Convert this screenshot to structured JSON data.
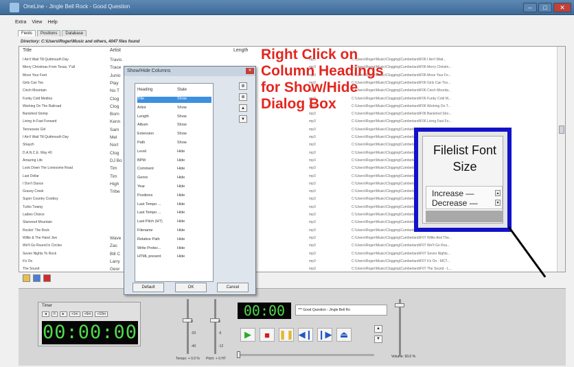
{
  "window": {
    "title": "OneLine - Jingle Bell Rock - Good Question",
    "icons": {
      "minimize": "minimize-icon",
      "maximize": "maximize-icon",
      "close": "close-icon"
    }
  },
  "menu": [
    "Extra",
    "View",
    "Help"
  ],
  "tabs": [
    "Fields",
    "Positions",
    "Database"
  ],
  "directory": "Directory: C:\\Users\\Roger\\Music and others, 4047 files found",
  "columns": {
    "title": "Title",
    "artist": "Artist",
    "length": "Length"
  },
  "files": [
    {
      "title": "I Ain't Wait Till Quittmouth Day",
      "artist": "Travis",
      "ext": "mp3",
      "path": "C:\\Users\\Roger\\Music\\Clogging\\Cumberland\\F06 I Ain't Wait..."
    },
    {
      "title": "Merry Christmas From Texas, Y'all",
      "artist": "Trace",
      "ext": "mp3",
      "path": "C:\\Users\\Roger\\Music\\Clogging\\Cumberland\\F06 Merry Christm..."
    },
    {
      "title": "Move Your Feet",
      "artist": "Junio",
      "ext": "mp3",
      "path": "C:\\Users\\Roger\\Music\\Clogging\\Cumberland\\F06 Move Your Fe..."
    },
    {
      "title": "Girls Can Too",
      "artist": "Play",
      "ext": "mp3",
      "path": "C:\\Users\\Roger\\Music\\Clogging\\Cumberland\\F06 Girls Can Too..."
    },
    {
      "title": "Cinch Mountain",
      "artist": "No T",
      "ext": "mp3",
      "path": "C:\\Users\\Roger\\Music\\Clogging\\Cumberland\\F06 Cinch Mounta..."
    },
    {
      "title": "Funky Cold Medina",
      "artist": "Clog",
      "ext": "mp3",
      "path": "C:\\Users\\Roger\\Music\\Clogging\\Cumberland\\F06 Funky Cold M..."
    },
    {
      "title": "Working On The Railroad",
      "artist": "Clog",
      "ext": "mp3",
      "path": "C:\\Users\\Roger\\Music\\Clogging\\Cumberland\\F06 Working On T..."
    },
    {
      "title": "Banished Stomp",
      "artist": "Born",
      "ext": "mp3",
      "path": "C:\\Users\\Roger\\Music\\Clogging\\Cumberland\\F06 Banished Stro..."
    },
    {
      "title": "Living In Fast Forward",
      "artist": "Kenn",
      "ext": "mp3",
      "path": "C:\\Users\\Roger\\Music\\Clogging\\Cumberland\\F06 Living Fast Fo..."
    },
    {
      "title": "Tennessee Girl",
      "artist": "Sam",
      "ext": "mp3",
      "path": "C:\\Users\\Roger\\Music\\Clogging\\Cumberland\\F06 Tennessee Girl..."
    },
    {
      "title": "I Ain't Wait Till Quittmouth Day",
      "artist": "Mel",
      "ext": "mp3",
      "path": "C:\\Users\\Roger\\Music\\Clogging\\Cumberland\\F06..."
    },
    {
      "title": "Shayzh",
      "artist": "Nort",
      "ext": "mp3",
      "path": "C:\\Users\\Roger\\Music\\Clogging\\Cumberland\\F06..."
    },
    {
      "title": "D.A.N.C.E. Way 40",
      "artist": "Clog",
      "ext": "mp3",
      "path": "C:\\Users\\Roger\\Music\\Clogging\\Cumberland\\F06..."
    },
    {
      "title": "Amazing Life",
      "artist": "DJ Bo",
      "ext": "mp3",
      "path": "C:\\Users\\Roger\\Music\\Clogging\\Cumberland\\F06..."
    },
    {
      "title": "Look Down The Lonesome Road",
      "artist": "Tim",
      "ext": "mp3",
      "path": "C:\\Users\\Roger\\Music\\Clogging\\Cumberland\\F06..."
    },
    {
      "title": "Last Dollar",
      "artist": "Tim",
      "ext": "mp3",
      "path": "C:\\Users\\Roger\\Music\\Clogging\\Cumberland\\F06..."
    },
    {
      "title": "I Don't Dance",
      "artist": "High",
      "ext": "mp3",
      "path": "C:\\Users\\Roger\\Music\\Clogging\\Cumberland\\F06..."
    },
    {
      "title": "Grassy Creek",
      "artist": "Tribe",
      "ext": "mp3",
      "path": "C:\\Users\\Roger\\Music\\Clogging\\Cumberland\\F06..."
    },
    {
      "title": "Super Country Cowboy",
      "artist": "",
      "ext": "mp3",
      "path": "C:\\Users\\Roger\\Music\\Clogging\\Cumberland\\F06..."
    },
    {
      "title": "Turbo Twang",
      "artist": "",
      "ext": "mp3",
      "path": "C:\\Users\\Roger\\Music\\Clogging\\Cumberland\\F06..."
    },
    {
      "title": "Ladies Choice",
      "artist": "",
      "ext": "mp3",
      "path": "C:\\Users\\Roger\\Music\\Clogging\\Cumberland\\F06..."
    },
    {
      "title": "Starwood Mountain",
      "artist": "",
      "ext": "mp3",
      "path": "C:\\Users\\Roger\\Music\\Clogging\\Cumberland\\F06..."
    },
    {
      "title": "Rockin' The Rock",
      "artist": "",
      "ext": "mp3",
      "path": "C:\\Users\\Roger\\Music\\Clogging\\Cumberland\\F06..."
    },
    {
      "title": "Willie & The Hand Jive",
      "artist": "Wave",
      "ext": "mp3",
      "path": "C:\\Users\\Roger\\Music\\Clogging\\Cumberland\\F07 Willie And The..."
    },
    {
      "title": "We'll Go Round In Circles",
      "artist": "Zac",
      "ext": "mp3",
      "path": "C:\\Users\\Roger\\Music\\Clogging\\Cumberland\\F07 We'll Go Rou..."
    },
    {
      "title": "Seven Nights To Rock",
      "artist": "Bill C",
      "ext": "mp3",
      "path": "C:\\Users\\Roger\\Music\\Clogging\\Cumberland\\F07 Seven Nights..."
    },
    {
      "title": "It's On",
      "artist": "Larry",
      "ext": "mp3",
      "path": "C:\\Users\\Roger\\Music\\Clogging\\Cumberland\\F07 It's On - MCT..."
    },
    {
      "title": "The Sound",
      "artist": "Geor",
      "ext": "mp3",
      "path": "C:\\Users\\Roger\\Music\\Clogging\\Cumberland\\F07 The Sound - L..."
    }
  ],
  "list_toolbar_icons": [
    "folder-icon",
    "add-icon",
    "remove-icon"
  ],
  "dialog": {
    "title": "Show/Hide Columns",
    "headers": {
      "heading": "Heading",
      "state": "State"
    },
    "rows": [
      {
        "heading": "Title",
        "state": "Show",
        "selected": true
      },
      {
        "heading": "Artist",
        "state": "Show"
      },
      {
        "heading": "Length",
        "state": "Show"
      },
      {
        "heading": "Album",
        "state": "Show"
      },
      {
        "heading": "Extension",
        "state": "Show"
      },
      {
        "heading": "Path",
        "state": "Show"
      },
      {
        "heading": "Level",
        "state": "Hide"
      },
      {
        "heading": "BPM",
        "state": "Hide"
      },
      {
        "heading": "Comment",
        "state": "Hide"
      },
      {
        "heading": "Genre",
        "state": "Hide"
      },
      {
        "heading": "Year",
        "state": "Hide"
      },
      {
        "heading": "Positions",
        "state": "Hide"
      },
      {
        "heading": "Last Tempo ...",
        "state": "Hide"
      },
      {
        "heading": "Last Tempo ...",
        "state": "Hide"
      },
      {
        "heading": "Last Pitch (HT)",
        "state": "Hide"
      },
      {
        "heading": "Filename",
        "state": "Hide"
      },
      {
        "heading": "Relative Path",
        "state": "Hide"
      },
      {
        "heading": "Write Protec...",
        "state": "Hide"
      },
      {
        "heading": "HTML present",
        "state": "Hide"
      }
    ],
    "buttons": {
      "default": "Default",
      "ok": "OK",
      "cancel": "Cancel"
    }
  },
  "annotation": "Right Click on Column Headings for Show/Hide Dialog Box",
  "font_size_panel": {
    "title": "Filelist Font Size",
    "increase": "Increase —",
    "decrease": "Decrease —"
  },
  "timer": {
    "label": "Timer",
    "buttons": [
      "◄",
      "II",
      "►",
      "+1m",
      "+5m",
      "+10m"
    ],
    "display": "00:00:00"
  },
  "pitch": {
    "tempo_label": "Tempo: + 0.0 %",
    "pitch_label": "Pitch: + 0 HT",
    "ticks": [
      "0",
      "-20",
      "-40",
      "0",
      "-6",
      "-12"
    ]
  },
  "player": {
    "time": "00:00",
    "now_playing": "*** Good Question - Jingle Bell Ro",
    "volume_label": "Volume: 93.0 %"
  },
  "colors": {
    "accent": "#1212c9",
    "annotation": "#e3261f",
    "lcd_text": "#52d94e"
  }
}
